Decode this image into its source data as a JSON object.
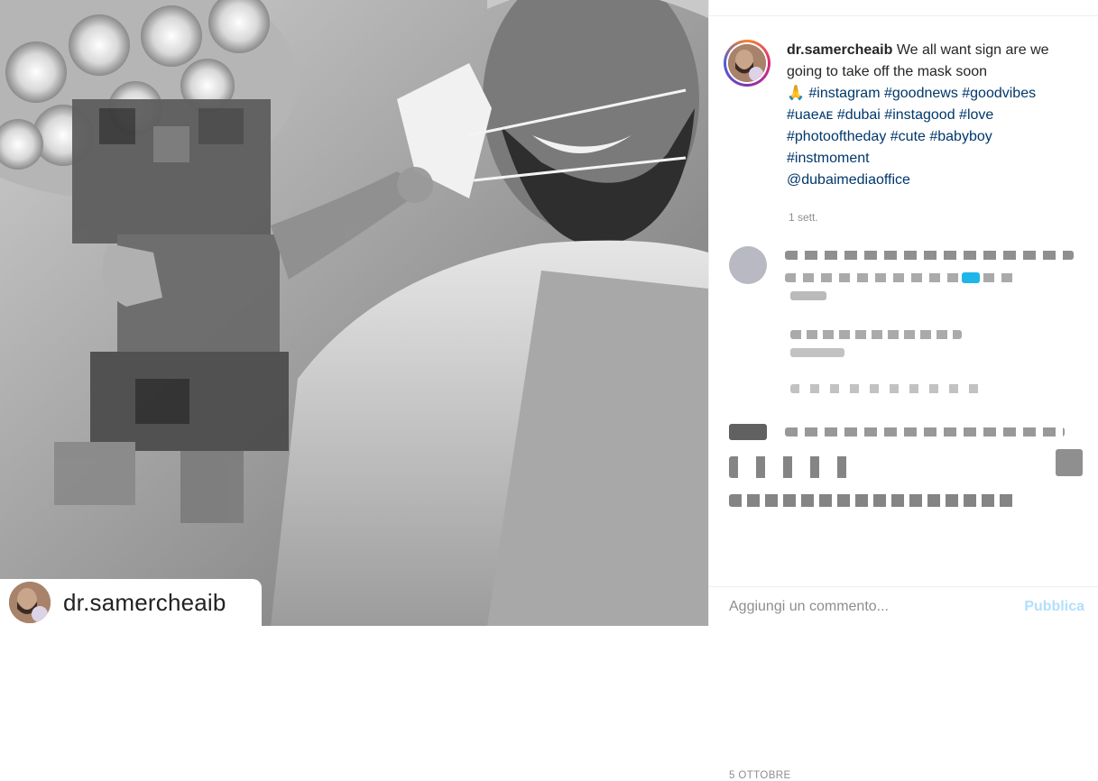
{
  "post": {
    "username": "dr.samercheaib",
    "caption_text": " We all want sign are we going to take off the mask soon",
    "emoji": "🙏",
    "hashtags_line": "#instagram #goodnews #goodvibes #uaeᴀᴇ #dubai #instagood #love #photooftheday #cute #babyboy #instmoment",
    "mention": "@dubaimediaoffice",
    "time_ago": "1 sett.",
    "date": "5 OTTOBRE"
  },
  "watermark": {
    "username": "dr.samercheaib"
  },
  "comment_box": {
    "placeholder": "Aggiungi un commento...",
    "publish_label": "Pubblica"
  },
  "colors": {
    "link": "#00376b",
    "publish_disabled": "#b2dffc",
    "muted": "#8e8e8e"
  }
}
